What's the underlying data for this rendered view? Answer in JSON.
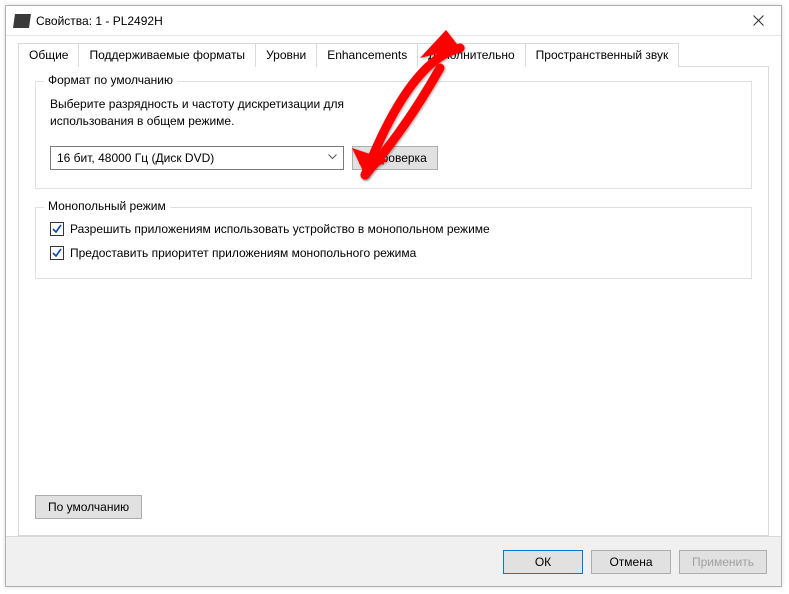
{
  "titlebar": {
    "title": "Свойства: 1 - PL2492H"
  },
  "tabs": {
    "list": [
      {
        "label": "Общие"
      },
      {
        "label": "Поддерживаемые форматы"
      },
      {
        "label": "Уровни"
      },
      {
        "label": "Enhancements"
      },
      {
        "label": "Дополнительно"
      },
      {
        "label": "Пространственный звук"
      }
    ],
    "activeIndex": 4
  },
  "defaultFormat": {
    "legend": "Формат по умолчанию",
    "description": "Выберите разрядность и частоту дискретизации для использования в общем режиме.",
    "selectValue": "16 бит, 48000 Гц (Диск DVD)",
    "testButton": "Проверка"
  },
  "exclusiveMode": {
    "legend": "Монопольный режим",
    "checkbox1": {
      "label": "Разрешить приложениям использовать устройство в монопольном режиме",
      "checked": true
    },
    "checkbox2": {
      "label": "Предоставить приоритет приложениям монопольного режима",
      "checked": true
    }
  },
  "buttons": {
    "defaults": "По умолчанию",
    "ok": "ОК",
    "cancel": "Отмена",
    "apply": "Применить"
  }
}
